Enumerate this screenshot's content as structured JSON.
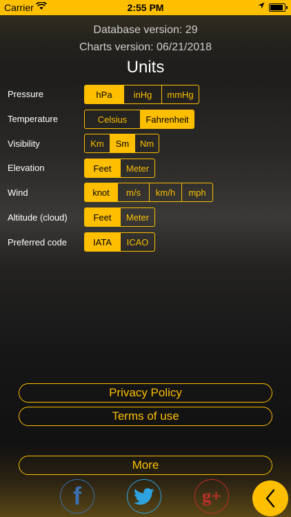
{
  "status": {
    "carrier": "Carrier",
    "time": "2:55 PM"
  },
  "info": {
    "database_version": "Database version: 29",
    "charts_version": "Charts version: 06/21/2018"
  },
  "title": "Units",
  "settings": [
    {
      "label": "Pressure",
      "options": [
        "hPa",
        "inHg",
        "mmHg"
      ],
      "selected": "hPa"
    },
    {
      "label": "Temperature",
      "options": [
        "Celsius",
        "Fahrenheit"
      ],
      "selected": "Fahrenheit"
    },
    {
      "label": "Visibility",
      "options": [
        "Km",
        "Sm",
        "Nm"
      ],
      "selected": "Sm"
    },
    {
      "label": "Elevation",
      "options": [
        "Feet",
        "Meter"
      ],
      "selected": "Feet"
    },
    {
      "label": "Wind",
      "options": [
        "knot",
        "m/s",
        "km/h",
        "mph"
      ],
      "selected": "knot"
    },
    {
      "label": "Altitude (cloud)",
      "options": [
        "Feet",
        "Meter"
      ],
      "selected": "Feet"
    },
    {
      "label": "Preferred code",
      "options": [
        "IATA",
        "ICAO"
      ],
      "selected": "IATA"
    }
  ],
  "links": {
    "privacy": "Privacy Policy",
    "terms": "Terms of use",
    "more": "More"
  },
  "social": {
    "facebook": "f",
    "google_plus": "g+"
  },
  "icons": {
    "facebook": "facebook-icon",
    "twitter": "twitter-icon",
    "google_plus": "google-plus-icon",
    "back": "chevron-left-icon"
  },
  "colors": {
    "accent": "#fdbf00",
    "facebook": "#3b6eb0",
    "twitter": "#2ea3df",
    "google_plus": "#c0302a"
  }
}
